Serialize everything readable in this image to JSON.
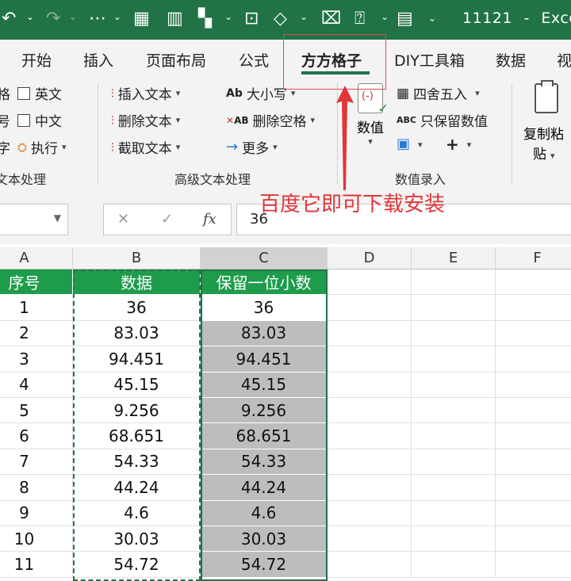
{
  "title_bar": {
    "doc_name": "11121",
    "separator": "-",
    "app_name": "Excel",
    "icons": [
      "undo-icon",
      "redo-icon",
      "borders-icon",
      "calculator-icon",
      "chart-icon",
      "pivot-icon",
      "screenshot-icon",
      "shapes-icon",
      "textbox-icon",
      "help-icon",
      "form-icon",
      "customize-icon"
    ]
  },
  "tabs": [
    "开始",
    "插入",
    "页面布局",
    "公式",
    "方方格子",
    "DIY工具箱",
    "数据",
    "视"
  ],
  "active_tab": "方方格子",
  "ribbon": {
    "left_partial": {
      "row1_prefix": "格",
      "row2_prefix": "号",
      "row3_prefix": "字",
      "checkbox1": "英文",
      "checkbox2": "中文",
      "exec": "执行",
      "group_label": "文本处理",
      "group_prefix": "文"
    },
    "advanced_text": {
      "insert_text": "插入文本",
      "delete_text": "删除文本",
      "extract_text": "截取文本",
      "case": "大小写",
      "delete_space": "删除空格",
      "more": "更多",
      "case_icon_text": "Ab",
      "space_icon_text": "AB",
      "group_label": "高级文本处理"
    },
    "numeric": {
      "value_btn": "数值",
      "round": "四舍五入",
      "keep_numbers": "只保留数值",
      "keep_icon_text": "ABC",
      "group_label": "数值录入"
    },
    "copy_paste": {
      "label_line1": "复制粘",
      "label_line2": "贴"
    }
  },
  "annotation": {
    "text": "百度它即可下载安装",
    "color": "#e0363a"
  },
  "formula_bar": {
    "name_box": "",
    "cancel": "✕",
    "confirm": "✓",
    "fx": "fx",
    "value": "36"
  },
  "sheet": {
    "columns": [
      "A",
      "B",
      "C",
      "D",
      "E",
      "F"
    ],
    "selected_column": "C",
    "headers": [
      "序号",
      "数据",
      "保留一位小数"
    ],
    "rows": [
      [
        "1",
        "36",
        "36"
      ],
      [
        "2",
        "83.03",
        "83.03"
      ],
      [
        "3",
        "94.451",
        "94.451"
      ],
      [
        "4",
        "45.15",
        "45.15"
      ],
      [
        "5",
        "9.256",
        "9.256"
      ],
      [
        "6",
        "68.651",
        "68.651"
      ],
      [
        "7",
        "54.33",
        "54.33"
      ],
      [
        "8",
        "44.24",
        "44.24"
      ],
      [
        "9",
        "4.6",
        "4.6"
      ],
      [
        "10",
        "30.03",
        "30.03"
      ],
      [
        "11",
        "54.72",
        "54.72"
      ]
    ]
  },
  "colors": {
    "excel_green": "#217346",
    "header_green": "#1e9c4c",
    "selected_fill": "#bdbdbd"
  }
}
